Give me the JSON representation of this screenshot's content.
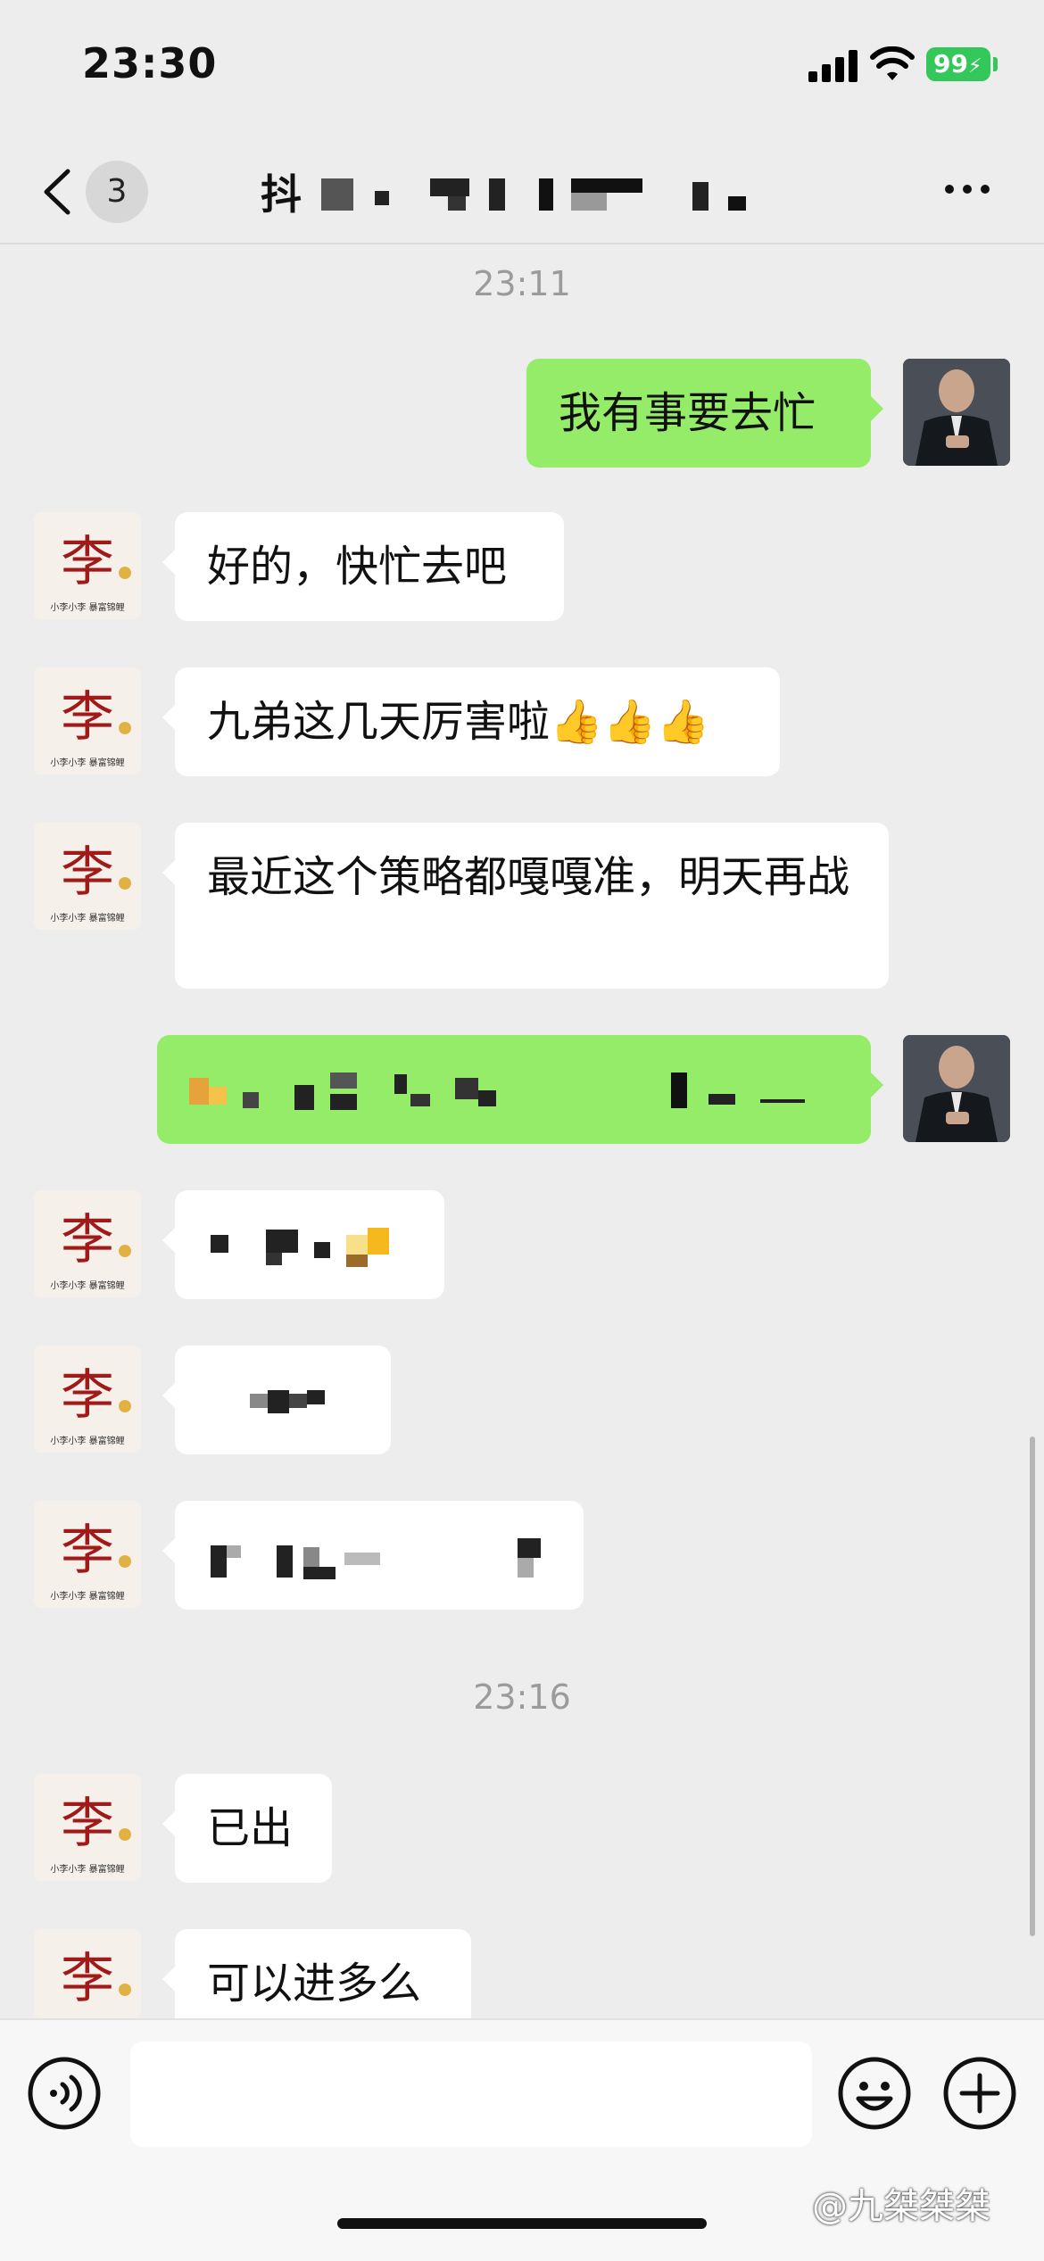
{
  "status_bar": {
    "time": "23:30",
    "battery": "99"
  },
  "nav": {
    "unread_count": "3",
    "title": "抖"
  },
  "chat": {
    "timestamp_1": "23:11",
    "timestamp_2": "23:16",
    "messages": [
      {
        "from": "me",
        "text": "我有事要去忙"
      },
      {
        "from": "contact",
        "text": "好的，快忙去吧"
      },
      {
        "from": "contact",
        "text": "九弟这几天厉害啦👍👍👍"
      },
      {
        "from": "contact",
        "text": "最近这个策略都嘎嘎准，明天再战"
      },
      {
        "from": "me",
        "text": ""
      },
      {
        "from": "contact",
        "text": ""
      },
      {
        "from": "contact",
        "text": ""
      },
      {
        "from": "contact",
        "text": ""
      },
      {
        "from": "contact",
        "text": "已出"
      },
      {
        "from": "contact",
        "text": "可以进多么"
      }
    ]
  },
  "avatar": {
    "contact_glyph": "李",
    "contact_caption": "小李小李  暴富锦鲤"
  },
  "input": {
    "value": ""
  },
  "watermark": "@九桀桀桀",
  "colors": {
    "background": "#ededed",
    "bubble_out": "#95ec69",
    "bubble_in": "#ffffff",
    "battery": "#34c759"
  }
}
